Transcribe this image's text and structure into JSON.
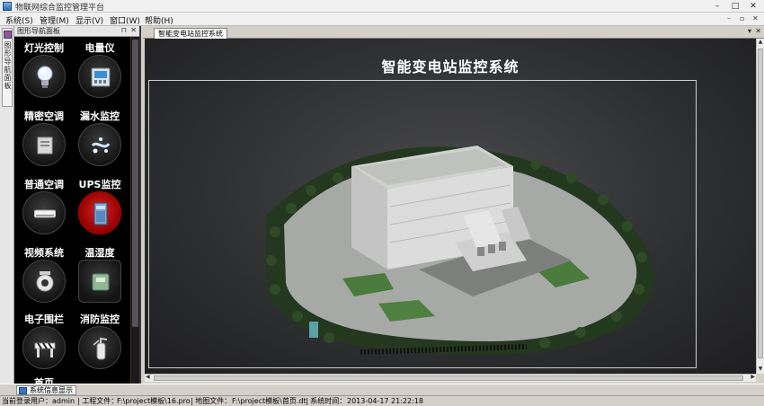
{
  "app": {
    "title": "物联网综合监控管理平台",
    "window_controls": [
      "–",
      "□",
      "✕"
    ]
  },
  "menu": {
    "items": [
      "系统(S)",
      "管理(M)",
      "显示(V)",
      "窗口(W)",
      "帮助(H)"
    ],
    "mdi_controls": [
      "–",
      "▫",
      "✕"
    ]
  },
  "left_strip": {
    "tab_label": "图形导航面板"
  },
  "nav_panel": {
    "title": "图形导航面板",
    "pin": "⊓",
    "close": "✕",
    "items": [
      {
        "label": "灯光控制",
        "icon": "light-bulb-icon"
      },
      {
        "label": "电量仪",
        "icon": "power-meter-icon"
      },
      {
        "label": "精密空调",
        "icon": "precision-ac-icon"
      },
      {
        "label": "漏水监控",
        "icon": "water-leak-icon"
      },
      {
        "label": "普通空调",
        "icon": "air-conditioner-icon"
      },
      {
        "label": "UPS监控",
        "icon": "ups-icon"
      },
      {
        "label": "视频系统",
        "icon": "camera-icon"
      },
      {
        "label": "温湿度",
        "icon": "thermo-hygro-icon"
      },
      {
        "label": "电子围栏",
        "icon": "barrier-fence-icon"
      },
      {
        "label": "消防监控",
        "icon": "fire-extinguisher-icon"
      },
      {
        "label": "首页",
        "icon": "home-icon"
      }
    ]
  },
  "document": {
    "tab_label": "智能变电站监控系统",
    "tab_menu": "▾",
    "tab_close": "✕",
    "heading": "智能变电站监控系统"
  },
  "bottom_tab": {
    "label": "系统信息显示"
  },
  "status": {
    "user_label": "当前登录用户：",
    "user": "admin",
    "project_label": "| 工程文件：",
    "project": "F:\\project模板\\16.pro",
    "map_label": "| 地图文件：",
    "map": "F:\\project模板\\首页.dt",
    "time_label": "| 系统时间：",
    "time": "2013-04-17 21:22:18"
  },
  "colors": {
    "nav_background": "#000000",
    "canvas_background": "#333436",
    "accent_red": "#d01010"
  }
}
